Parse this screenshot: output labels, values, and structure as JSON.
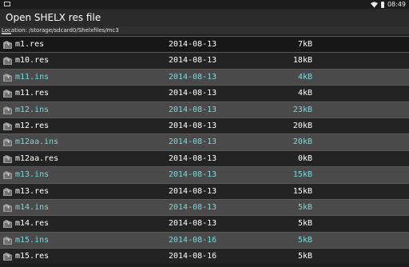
{
  "status": {
    "time": "08:49"
  },
  "title": "Open SHELX res file",
  "location": "Location: /storage/sdcard0/Shelxfiles/mc3",
  "files": [
    {
      "name": "m1.res",
      "date": "2014-08-13",
      "size": "7kB",
      "style": "dark"
    },
    {
      "name": "m10.res",
      "date": "2014-08-13",
      "size": "18kB",
      "style": "mid"
    },
    {
      "name": "m11.ins",
      "date": "2014-08-13",
      "size": "4kB",
      "style": "hl"
    },
    {
      "name": "m11.res",
      "date": "2014-08-13",
      "size": "4kB",
      "style": "mid"
    },
    {
      "name": "m12.ins",
      "date": "2014-08-13",
      "size": "23kB",
      "style": "hl"
    },
    {
      "name": "m12.res",
      "date": "2014-08-13",
      "size": "20kB",
      "style": "mid"
    },
    {
      "name": "m12aa.ins",
      "date": "2014-08-13",
      "size": "20kB",
      "style": "hl"
    },
    {
      "name": "m12aa.res",
      "date": "2014-08-13",
      "size": "0kB",
      "style": "mid"
    },
    {
      "name": "m13.ins",
      "date": "2014-08-13",
      "size": "15kB",
      "style": "hl"
    },
    {
      "name": "m13.res",
      "date": "2014-08-13",
      "size": "15kB",
      "style": "mid"
    },
    {
      "name": "m14.ins",
      "date": "2014-08-13",
      "size": "5kB",
      "style": "hl"
    },
    {
      "name": "m14.res",
      "date": "2014-08-13",
      "size": "5kB",
      "style": "mid"
    },
    {
      "name": "m15.ins",
      "date": "2014-08-16",
      "size": "5kB",
      "style": "hl"
    },
    {
      "name": "m15.res",
      "date": "2014-08-16",
      "size": "5kB",
      "style": "mid"
    }
  ]
}
